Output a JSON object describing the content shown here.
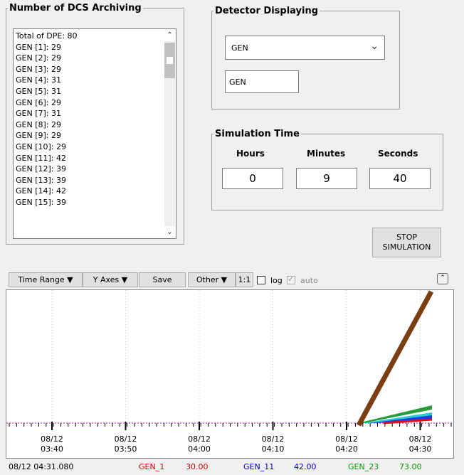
{
  "archiving": {
    "title": "Number of DCS Archiving",
    "items": [
      "Total of DPE: 80",
      "GEN [1]: 29",
      "GEN [2]: 29",
      "GEN [3]: 29",
      "GEN [4]: 31",
      "GEN [5]: 31",
      "GEN [6]: 29",
      "GEN [7]: 31",
      "GEN [8]: 29",
      "GEN [9]: 29",
      "GEN [10]: 29",
      "GEN [11]: 42",
      "GEN [12]: 39",
      "GEN [13]: 39",
      "GEN [14]: 42",
      "GEN [15]: 39"
    ]
  },
  "detector": {
    "title": "Detector Displaying",
    "selected": "GEN",
    "text_value": "GEN"
  },
  "simulation": {
    "title": "Simulation Time",
    "hours_label": "Hours",
    "minutes_label": "Minutes",
    "seconds_label": "Seconds",
    "hours": "0",
    "minutes": "9",
    "seconds": "40",
    "stop_label_line1": "STOP",
    "stop_label_line2": "SIMULATION"
  },
  "toolbar": {
    "time_range": "Time Range",
    "y_axes": "Y Axes",
    "save": "Save",
    "other": "Other",
    "one_to_one": "1:1",
    "log": "log",
    "auto": "auto",
    "log_checked": false,
    "auto_checked": true
  },
  "chart_data": {
    "type": "line",
    "x_ticks": [
      {
        "date": "08/12",
        "time": "03:40"
      },
      {
        "date": "08/12",
        "time": "03:50"
      },
      {
        "date": "08/12",
        "time": "04:00"
      },
      {
        "date": "08/12",
        "time": "04:10"
      },
      {
        "date": "08/12",
        "time": "04:20"
      },
      {
        "date": "08/12",
        "time": "04:30"
      }
    ],
    "series": [
      {
        "color": "#7a3e12"
      },
      {
        "color": "#2a9a3a"
      },
      {
        "color": "#22d0d0"
      },
      {
        "color": "#1c3cf0"
      },
      {
        "color": "#e01010"
      }
    ]
  },
  "status": {
    "cursor_time": "08/12 04:31.080",
    "entries": [
      {
        "name": "GEN_1",
        "value": "30.00",
        "color": "#e00000"
      },
      {
        "name": "GEN_11",
        "value": "42.00",
        "color": "#0000e0"
      },
      {
        "name": "GEN_23",
        "value": "73.00",
        "color": "#00a000"
      }
    ]
  }
}
